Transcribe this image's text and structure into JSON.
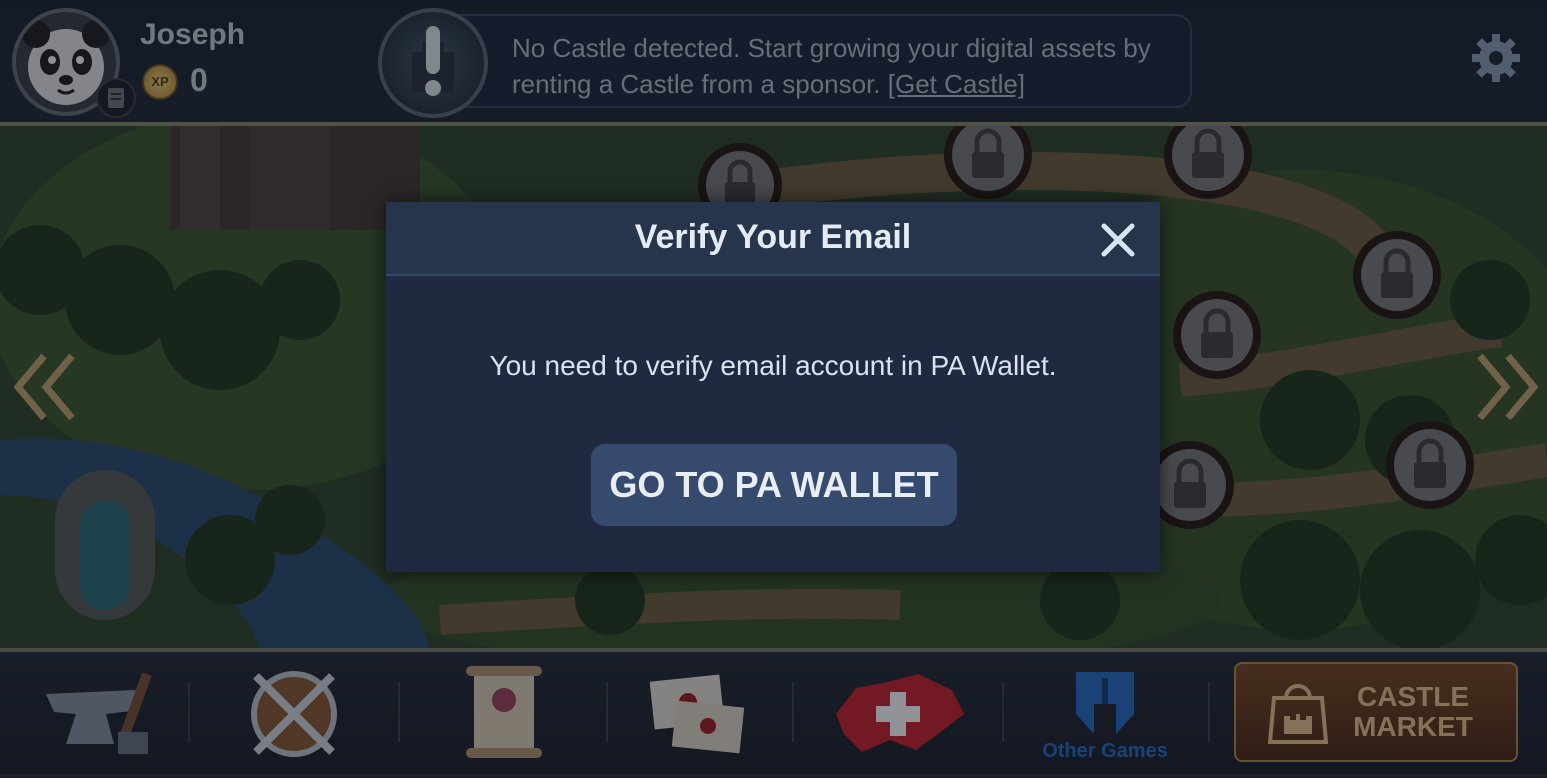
{
  "player": {
    "name": "Joseph",
    "xp_icon_label": "XP",
    "xp_value": "0"
  },
  "notice": {
    "text": "No Castle detected. Start growing your digital assets by renting a Castle from a sponsor. ",
    "link_text": "[Get Castle]"
  },
  "modal": {
    "title": "Verify Your Email",
    "message": "You need to verify email account in PA Wallet.",
    "button_label": "GO TO PA WALLET"
  },
  "bottom_bar": {
    "other_games_label": "Other Games",
    "castle_market_label_line1": "CASTLE",
    "castle_market_label_line2": "MARKET"
  },
  "icons": {
    "settings": "gear-icon",
    "close": "close-icon",
    "prev": "double-chevron-left-icon",
    "next": "double-chevron-right-icon",
    "notice": "exclamation-icon",
    "map_lock": "padlock-icon",
    "forge": "anvil-icon",
    "battle": "crossed-swords-shield-icon",
    "quests": "scroll-icon",
    "mail": "envelopes-icon",
    "region": "switzerland-map-icon",
    "other_games": "helmet-icon",
    "castle_market": "shopping-bag-castle-icon"
  },
  "colors": {
    "modal_bg": "#1f2a40",
    "modal_button": "#364a6e",
    "castle_market": "#6a3f1c",
    "other_games": "#2b6ec4"
  }
}
